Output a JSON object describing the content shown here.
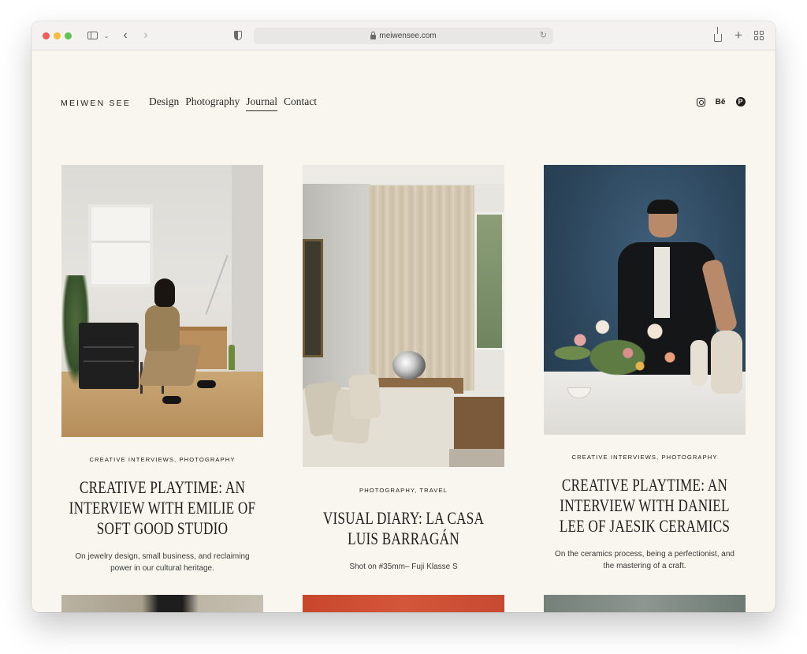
{
  "browser": {
    "url": "meiwensee.com"
  },
  "site": {
    "logo": "MEIWEN SEE",
    "nav": [
      {
        "label": "Design",
        "active": false
      },
      {
        "label": "Photography",
        "active": false
      },
      {
        "label": "Journal",
        "active": true
      },
      {
        "label": "Contact",
        "active": false
      }
    ],
    "social": {
      "behance_label": "Bē"
    }
  },
  "posts": [
    {
      "categories": "CREATIVE INTERVIEWS, PHOTOGRAPHY",
      "title_lines": [
        "CREATIVE PLAYTIME: AN",
        "INTERVIEW WITH EMILIE OF",
        "SOFT GOOD STUDIO"
      ],
      "description_lines": [
        "On jewelry design, small business, and reclaiming",
        "power in our cultural heritage."
      ]
    },
    {
      "categories": "PHOTOGRAPHY, TRAVEL",
      "title_lines": [
        "VISUAL DIARY: LA CASA",
        "LUIS BARRAGÁN"
      ],
      "description_lines": [
        "Shot on #35mm– Fuji Klasse S"
      ]
    },
    {
      "categories": "CREATIVE INTERVIEWS, PHOTOGRAPHY",
      "title_lines": [
        "CREATIVE PLAYTIME: AN",
        "INTERVIEW WITH DANIEL",
        "LEE OF JAESIK CERAMICS"
      ],
      "description_lines": [
        "On the ceramics process, being a perfectionist, and",
        "the mastering of a craft."
      ]
    }
  ]
}
